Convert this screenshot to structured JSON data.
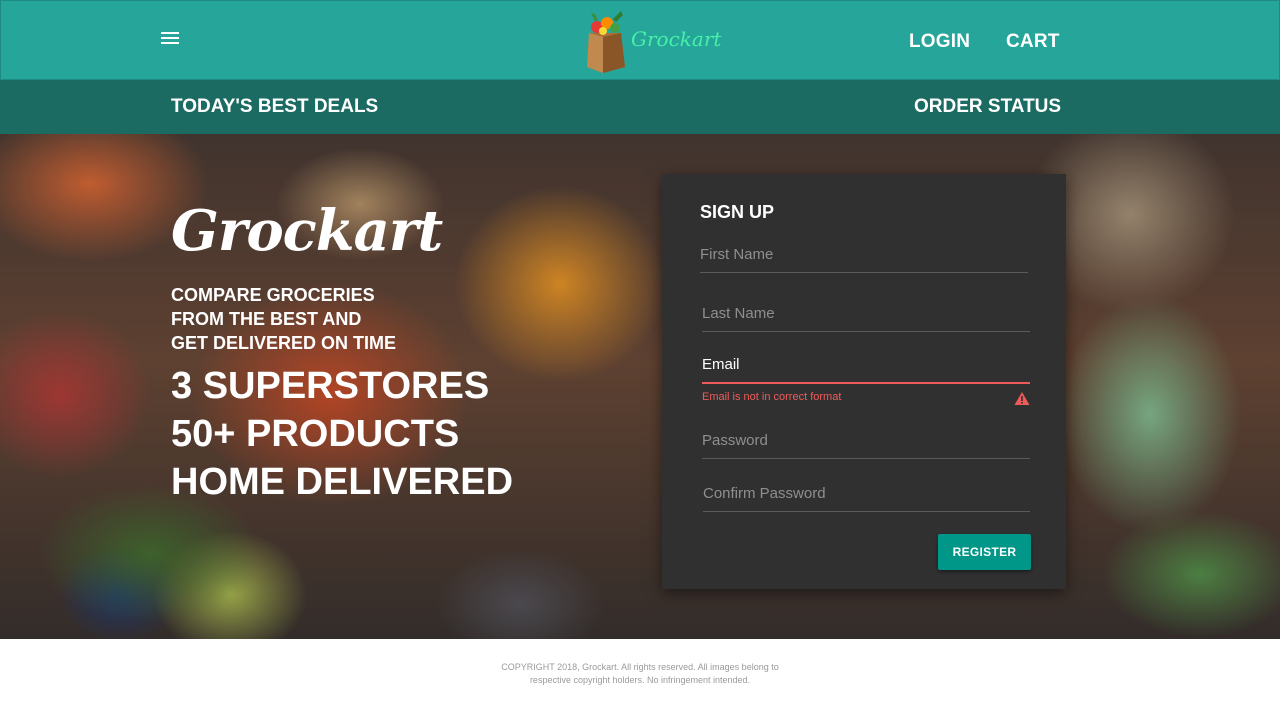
{
  "header": {
    "menu_icon": "hamburger-menu-icon",
    "logo_text": "Grockart",
    "logo_icon": "grocery-bag-icon",
    "login_label": "LOGIN",
    "cart_label": "CART",
    "colors": {
      "header_bg": "#26a69a",
      "subbar_bg": "#1b6b63"
    }
  },
  "subnav": {
    "deals_label": "TODAY'S BEST DEALS",
    "order_status_label": "ORDER STATUS"
  },
  "hero": {
    "brand": "Grockart",
    "tagline_lines": [
      "COMPARE GROCERIES",
      "FROM THE BEST AND",
      "GET DELIVERED ON TIME"
    ],
    "stats_lines": [
      "3 SUPERSTORES",
      "50+ PRODUCTS",
      "HOME DELIVERED"
    ]
  },
  "signup": {
    "title": "SIGN UP",
    "first_name_placeholder": "First Name",
    "last_name_placeholder": "Last Name",
    "email_value": "Email",
    "email_error": "Email is not in correct format",
    "password_placeholder": "Password",
    "confirm_password_placeholder": "Confirm Password",
    "register_label": "REGISTER",
    "warning_icon": "warning-triangle-icon",
    "colors": {
      "card_bg": "#303030",
      "error": "#ef5b5b",
      "button_bg": "#009688"
    }
  },
  "footer": {
    "copyright_line1": "COPYRIGHT 2018, Grockart. All rights reserved. All images belong to",
    "copyright_line2": "respective copyright holders. No infringement intended."
  }
}
